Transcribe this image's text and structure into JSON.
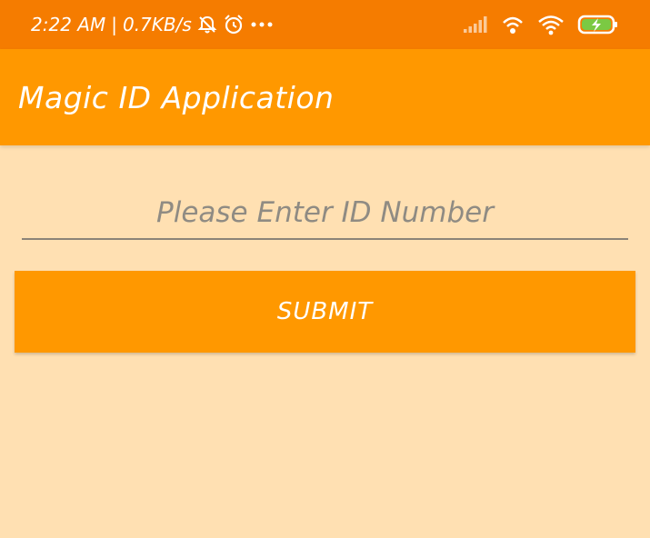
{
  "status_bar": {
    "time": "2:22 AM",
    "separator": "|",
    "net_speed": "0.7KB/s",
    "icons": [
      "muted-bell-icon",
      "alarm-clock-icon",
      "more-dots-icon",
      "signal-icon",
      "hotspot-icon",
      "wifi-icon",
      "battery-charging-icon"
    ]
  },
  "app_bar": {
    "title": "Magic ID Application"
  },
  "form": {
    "id_placeholder": "Please Enter ID Number",
    "id_value": "",
    "submit_label": "SUBMIT"
  },
  "colors": {
    "status_bar": "#F57C00",
    "primary": "#FF9800",
    "background": "#FFE0B2",
    "battery_fill": "#7BC943"
  }
}
